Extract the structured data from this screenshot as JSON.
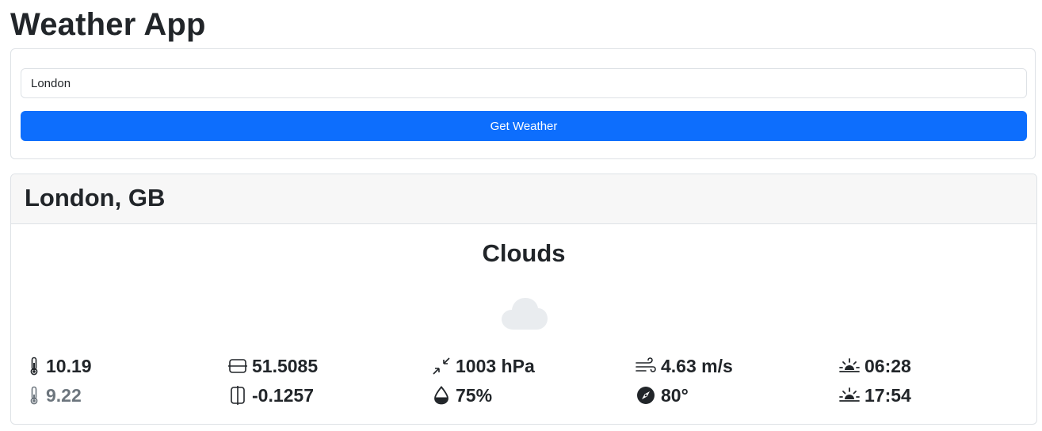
{
  "app": {
    "title": "Weather App"
  },
  "search": {
    "value": "London",
    "button_label": "Get Weather"
  },
  "weather": {
    "location": "London, GB",
    "condition": "Clouds",
    "condition_icon": "cloud-icon",
    "temperature": "10.19",
    "feels_like": "9.22",
    "latitude": "51.5085",
    "longitude": "-0.1257",
    "pressure": "1003 hPa",
    "humidity": "75%",
    "wind_speed": "4.63 m/s",
    "wind_direction": "80°",
    "sunrise": "06:28",
    "sunset": "17:54"
  },
  "colors": {
    "primary": "#0d6efd",
    "text": "#212529",
    "muted": "#6c757d",
    "border": "#dee2e6",
    "header_bg": "#f7f7f7",
    "cloud": "#e9ecef"
  }
}
